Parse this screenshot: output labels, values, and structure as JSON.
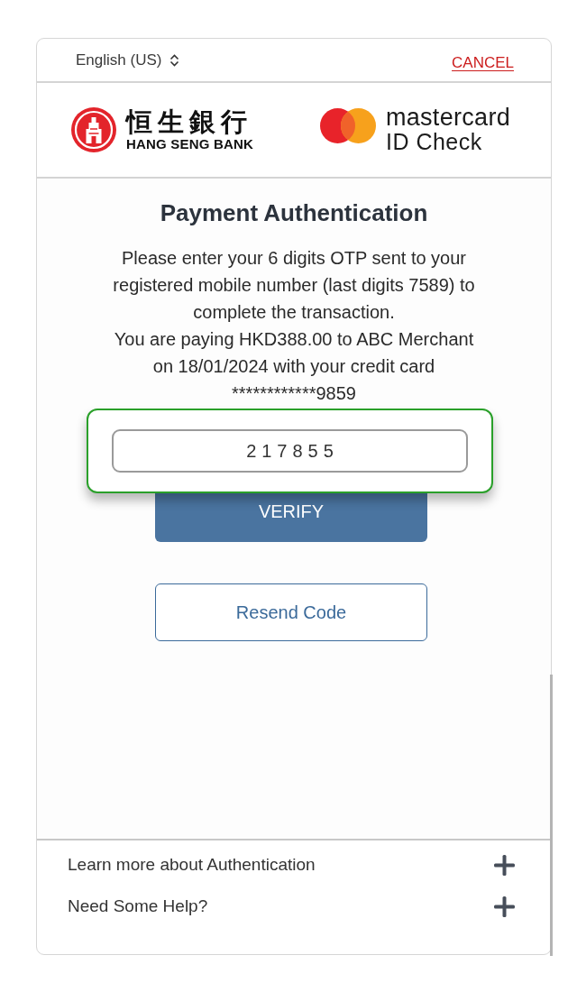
{
  "top_bar": {
    "language": "English (US)",
    "cancel": "CANCEL"
  },
  "logos": {
    "bank_chinese": "恒生銀行",
    "bank_english": "HANG SENG BANK",
    "card_brand": "mastercard",
    "card_program": "ID Check"
  },
  "main": {
    "title": "Payment Authentication",
    "paragraphs": [
      "Please enter your 6 digits OTP sent to your registered mobile number (last digits 7589) to complete the transaction.",
      "You are paying HKD388.00 to ABC Merchant on 18/01/2024 with your credit card ************9859"
    ],
    "otp_field": {
      "value": "217855"
    },
    "buttons": [
      {
        "label": "VERIFY",
        "kind": "primary"
      },
      {
        "label": "Resend Code",
        "kind": "secondary"
      }
    ]
  },
  "footer": {
    "items": [
      {
        "label": "Learn more about Authentication",
        "expanded": false
      },
      {
        "label": "Need Some Help?",
        "expanded": false
      }
    ]
  }
}
